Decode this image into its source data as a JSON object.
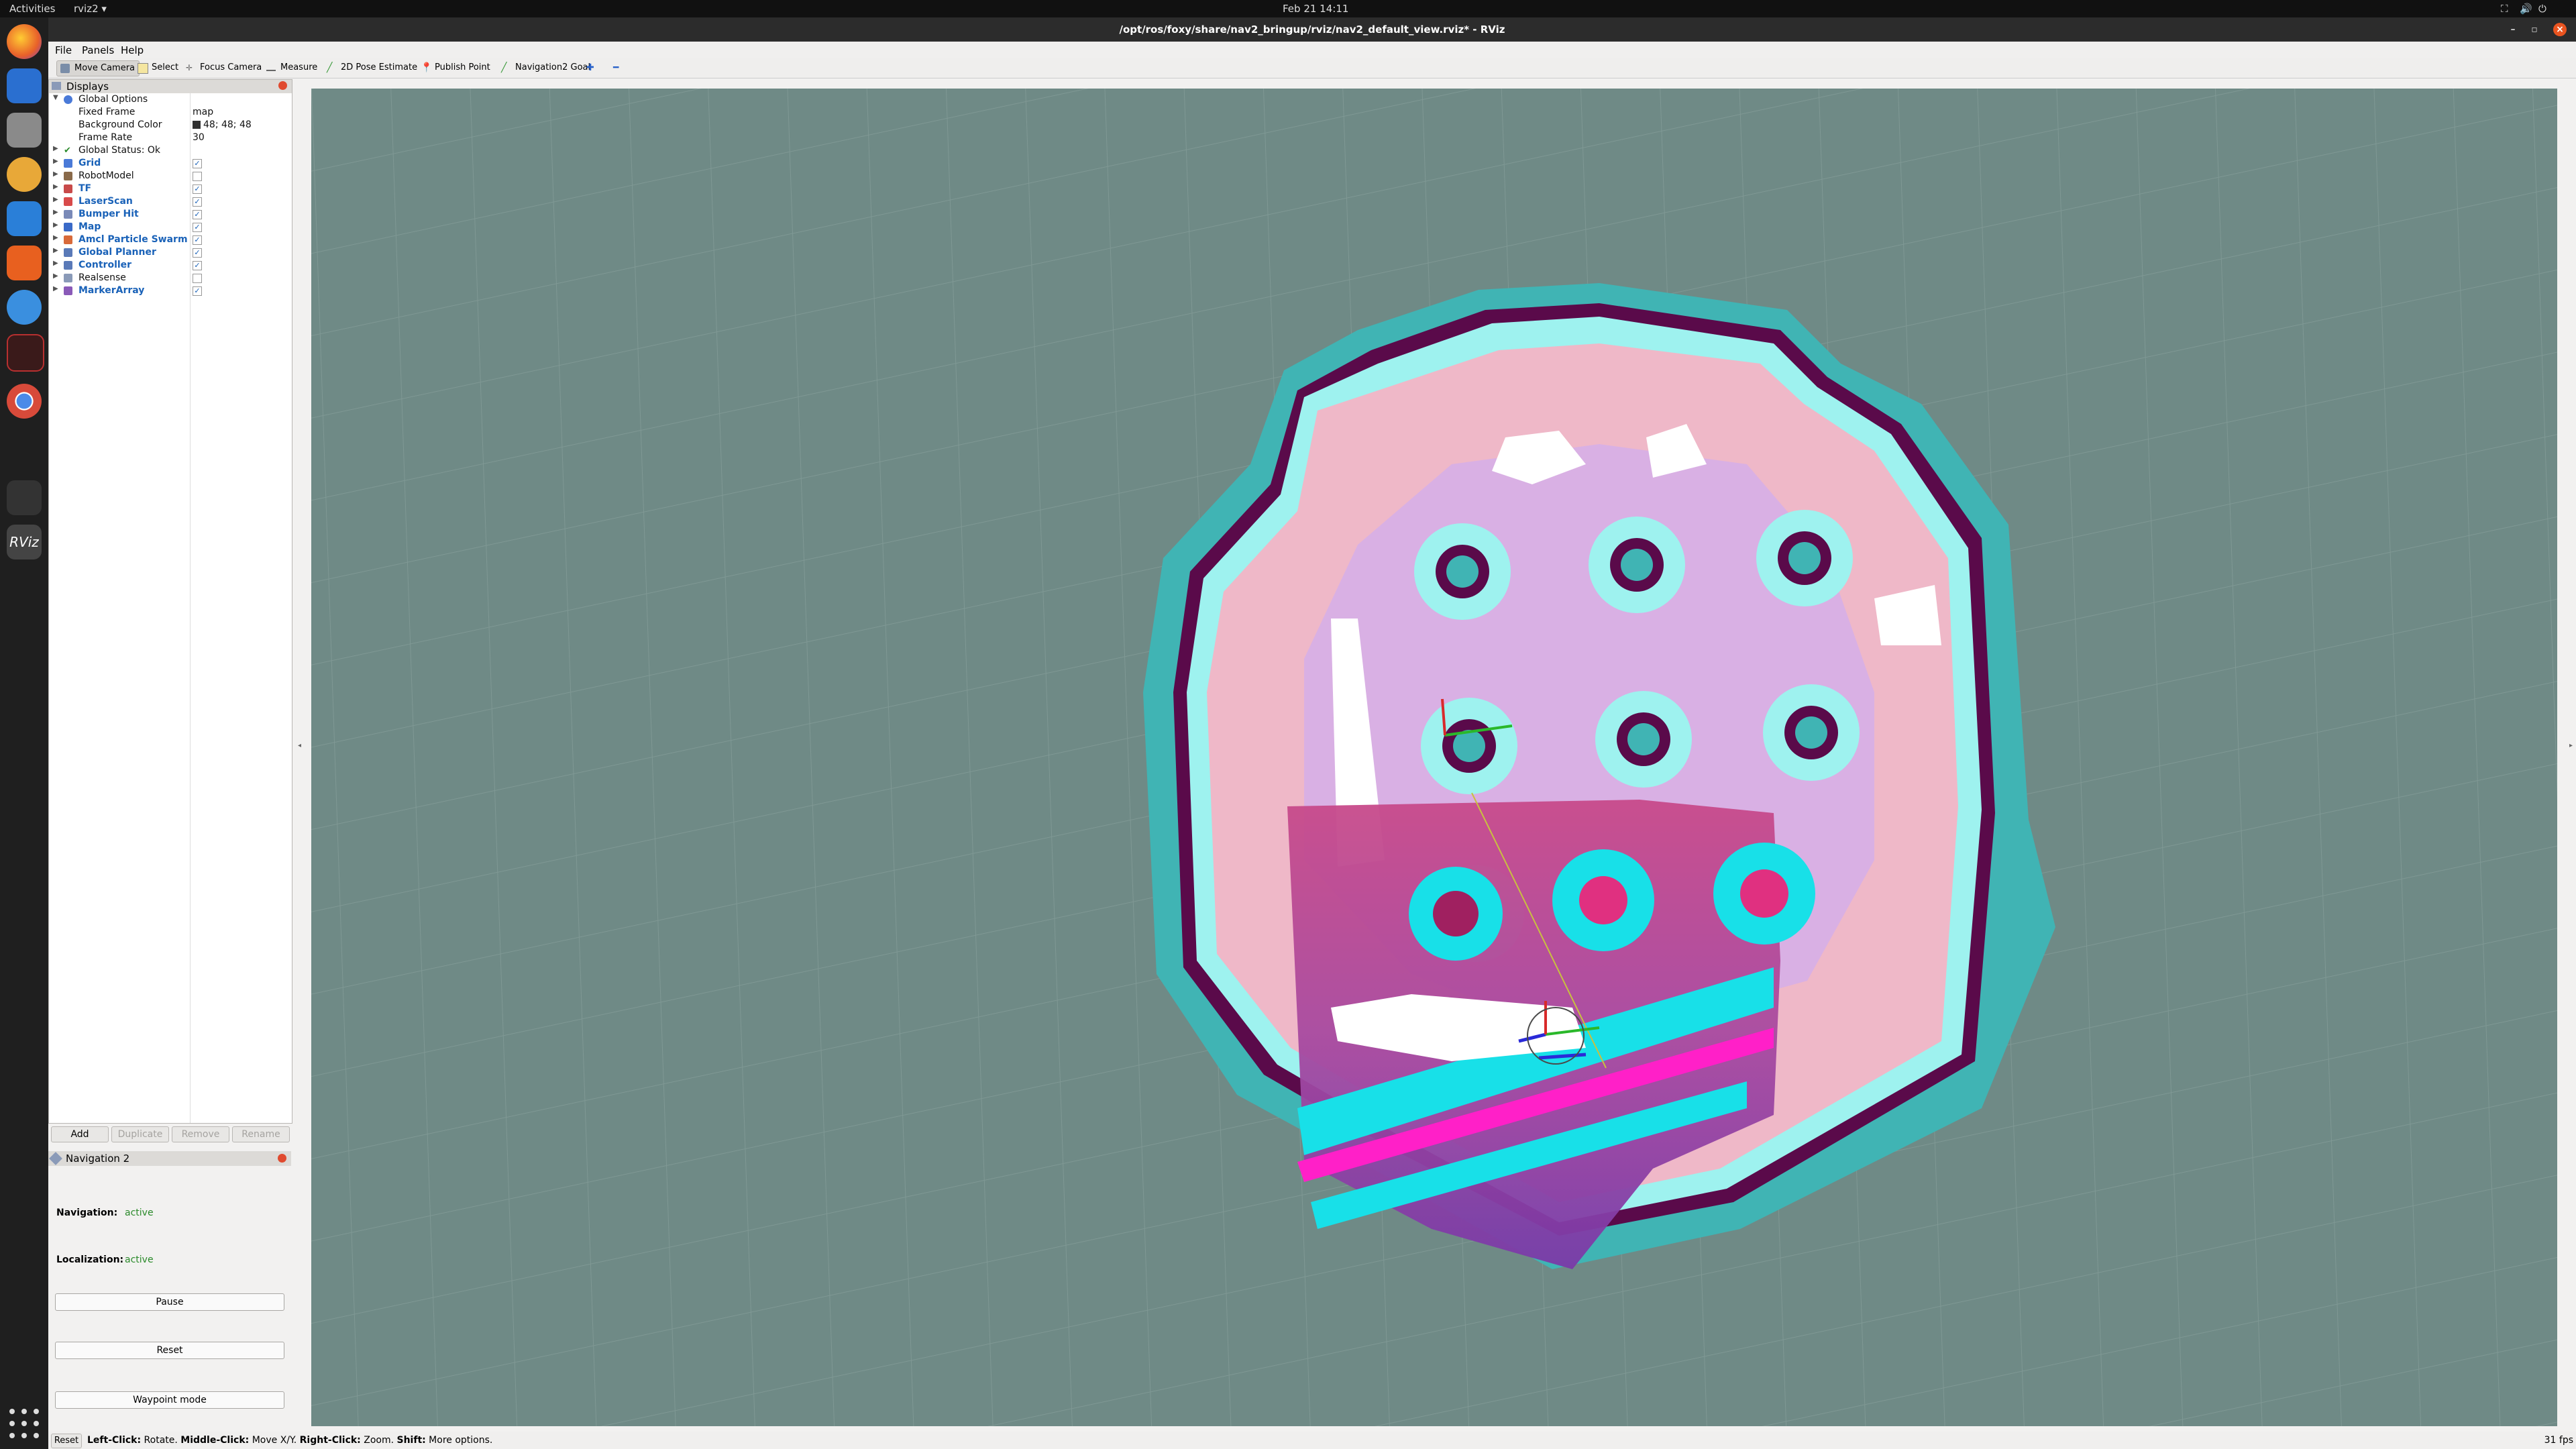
{
  "topbar": {
    "activities": "Activities",
    "app": "rviz2 ▾",
    "clock": "Feb 21  14:11"
  },
  "dock": [
    "firefox",
    "thunderbird",
    "files",
    "rhythmbox",
    "libreoffice-writer",
    "software-center",
    "help",
    "terminal",
    "chrome",
    "sublime",
    "rviz"
  ],
  "window": {
    "title": "/opt/ros/foxy/share/nav2_bringup/rviz/nav2_default_view.rviz* - RViz",
    "menus": [
      "File",
      "Panels",
      "Help"
    ]
  },
  "toolbar": {
    "tools": [
      {
        "label": "Move Camera",
        "active": true,
        "icon": "move-camera-icon"
      },
      {
        "label": "Select",
        "active": false,
        "icon": "select-icon"
      },
      {
        "label": "Focus Camera",
        "active": false,
        "icon": "focus-camera-icon"
      },
      {
        "label": "Measure",
        "active": false,
        "icon": "measure-icon"
      },
      {
        "label": "2D Pose Estimate",
        "active": false,
        "icon": "pose-estimate-icon"
      },
      {
        "label": "Publish Point",
        "active": false,
        "icon": "publish-point-icon"
      },
      {
        "label": "Navigation2 Goal",
        "active": false,
        "icon": "nav-goal-icon"
      }
    ]
  },
  "displays": {
    "title": "Displays",
    "global_options": "Global Options",
    "fixed_frame_label": "Fixed Frame",
    "fixed_frame_value": "map",
    "bg_color_label": "Background Color",
    "bg_color_value": "48; 48; 48",
    "frame_rate_label": "Frame Rate",
    "frame_rate_value": "30",
    "global_status": "Global Status: Ok",
    "items": [
      {
        "name": "Grid",
        "checked": true,
        "bold": true,
        "color": "#1a62b8"
      },
      {
        "name": "RobotModel",
        "checked": false,
        "bold": false,
        "color": "#111111"
      },
      {
        "name": "TF",
        "checked": true,
        "bold": true,
        "color": "#1a62b8"
      },
      {
        "name": "LaserScan",
        "checked": true,
        "bold": true,
        "color": "#1a62b8"
      },
      {
        "name": "Bumper Hit",
        "checked": true,
        "bold": true,
        "color": "#1a62b8"
      },
      {
        "name": "Map",
        "checked": true,
        "bold": true,
        "color": "#1a62b8"
      },
      {
        "name": "Amcl Particle Swarm",
        "checked": true,
        "bold": true,
        "color": "#1a62b8"
      },
      {
        "name": "Global Planner",
        "checked": true,
        "bold": true,
        "color": "#1a62b8"
      },
      {
        "name": "Controller",
        "checked": true,
        "bold": true,
        "color": "#1a62b8"
      },
      {
        "name": "Realsense",
        "checked": false,
        "bold": false,
        "color": "#111111"
      },
      {
        "name": "MarkerArray",
        "checked": true,
        "bold": true,
        "color": "#1a62b8"
      }
    ],
    "buttons": {
      "add": "Add",
      "duplicate": "Duplicate",
      "remove": "Remove",
      "rename": "Rename"
    }
  },
  "navigation2": {
    "title": "Navigation 2",
    "navigation_label": "Navigation:",
    "navigation_value": "active",
    "localization_label": "Localization:",
    "localization_value": "active",
    "pause": "Pause",
    "reset": "Reset",
    "waypoint": "Waypoint mode"
  },
  "statusbar": {
    "reset": "Reset",
    "hint_parts": [
      {
        "b": "Left-Click:",
        "t": " Rotate. "
      },
      {
        "b": "Middle-Click:",
        "t": " Move X/Y. "
      },
      {
        "b": "Right-Click:",
        "t": " Zoom. "
      },
      {
        "b": "Shift:",
        "t": " More options."
      }
    ],
    "fps": "31 fps"
  },
  "colors": {
    "viewport_bg": "#6f8a86",
    "accent": "#1a62b8",
    "active_green": "#2a8a2a"
  }
}
